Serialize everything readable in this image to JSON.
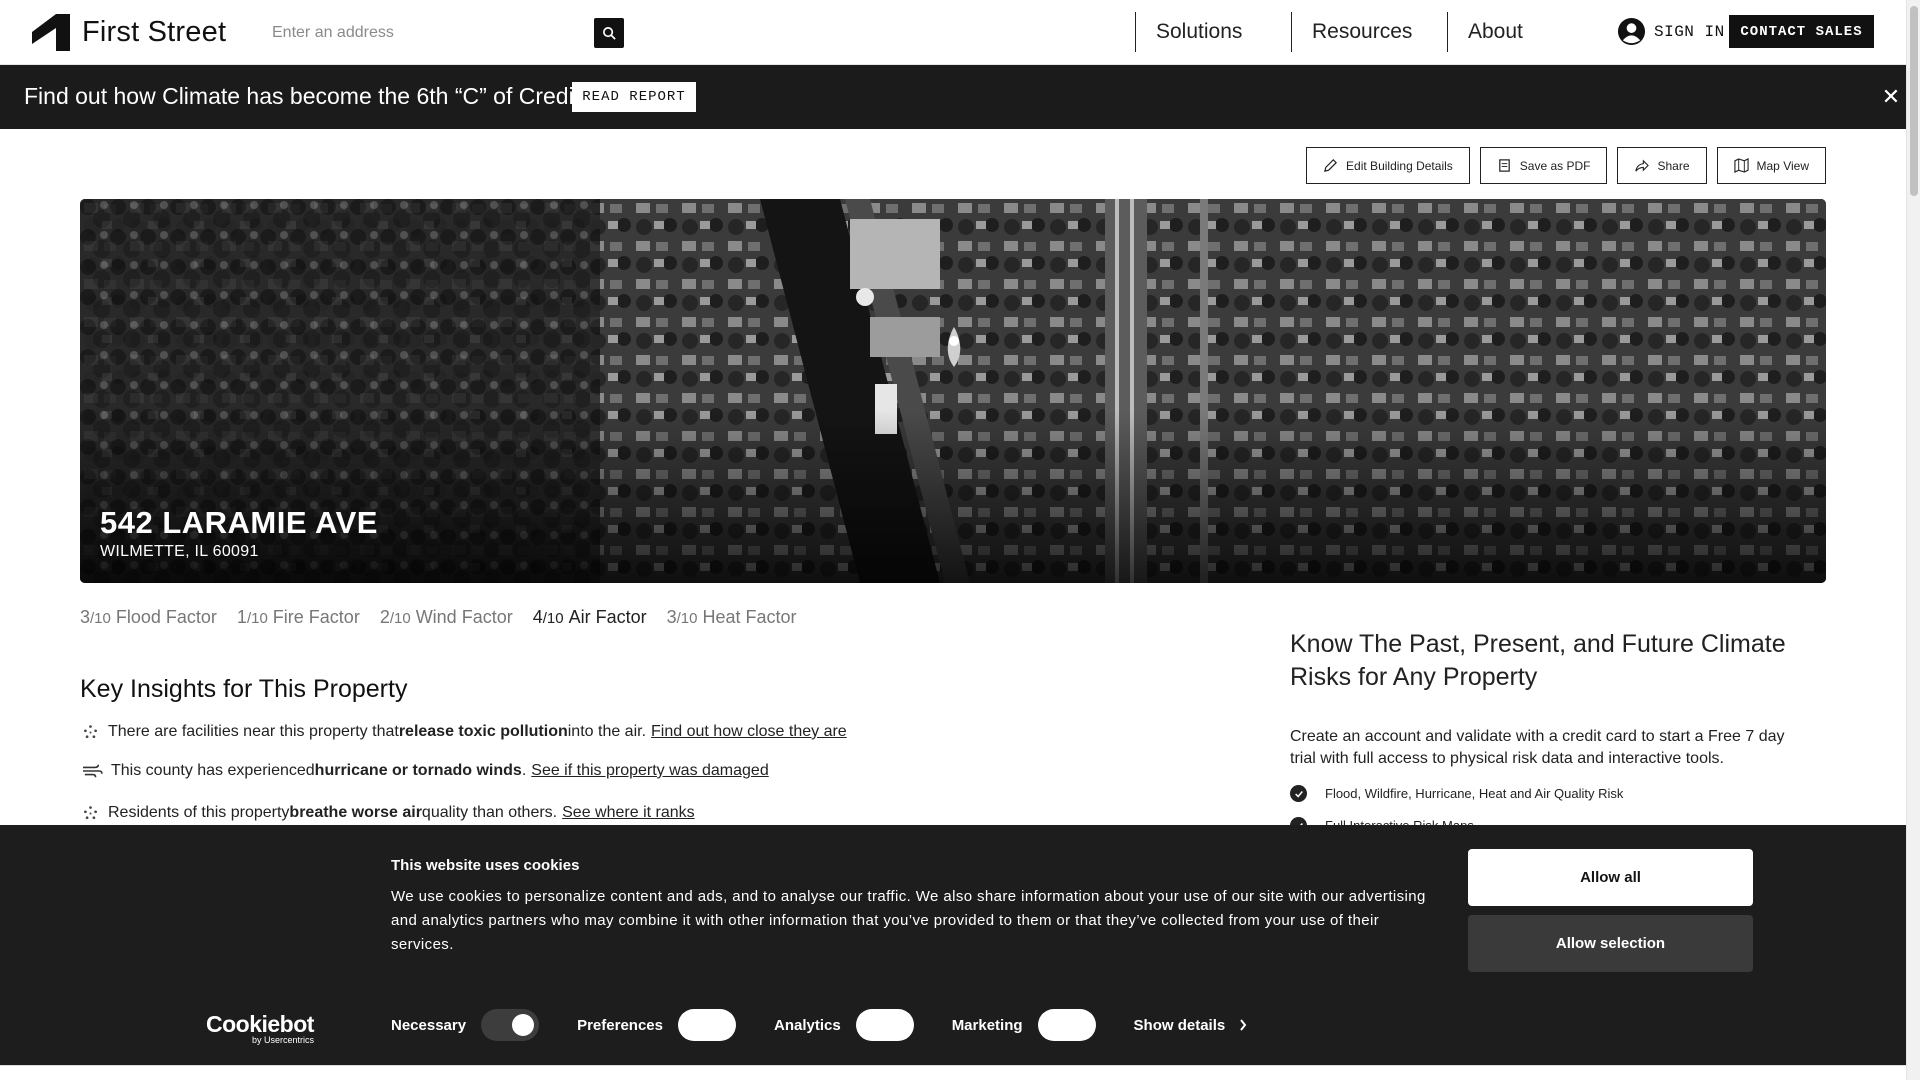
{
  "header": {
    "logo_text": "First Street",
    "search_placeholder": "Enter an address",
    "nav": [
      "Solutions",
      "Resources",
      "About"
    ],
    "sign_in": "SIGN IN",
    "contact": "CONTACT SALES"
  },
  "banner": {
    "text": "Find out how Climate has become the 6th “C” of Credit",
    "button": "READ REPORT",
    "close": "✕"
  },
  "actions": {
    "edit": "Edit Building Details",
    "pdf": "Save as PDF",
    "share": "Share",
    "map": "Map View"
  },
  "property": {
    "address": "542 LARAMIE AVE",
    "city": "WILMETTE, IL 60091"
  },
  "factors": [
    {
      "score": "3",
      "max": "/10",
      "label": "Flood Factor"
    },
    {
      "score": "1",
      "max": "/10",
      "label": "Fire Factor"
    },
    {
      "score": "2",
      "max": "/10",
      "label": "Wind Factor"
    },
    {
      "score": "4",
      "max": "/10",
      "label": "Air Factor"
    },
    {
      "score": "3",
      "max": "/10",
      "label": "Heat Factor"
    }
  ],
  "insights": {
    "title": "Key Insights for This Property",
    "items": [
      {
        "pre": "There are facilities near this property that ",
        "bold": "release toxic pollution",
        "post": " into the air.",
        "link": "Find out how close they are"
      },
      {
        "pre": "This county has experienced ",
        "bold": "hurricane or tornado winds",
        "post": ".",
        "link": "See if this property was damaged"
      },
      {
        "pre": "Residents of this property ",
        "bold": "breathe worse air",
        "post": " quality than others.",
        "link": "See where it ranks"
      }
    ]
  },
  "panel": {
    "title": "Know The Past, Present, and Future Climate Risks for Any Property",
    "desc": "Create an account and validate with a credit card to start a Free 7 day trial with full access to physical risk data and interactive tools.",
    "features": [
      "Flood, Wildfire, Hurricane, Heat and Air Quality Risk",
      "Full Interactive Risk Maps"
    ]
  },
  "cookie": {
    "title": "This website uses cookies",
    "text": "We use cookies to personalize content and ads, and to analyse our traffic. We also share information about your use of our site with our advertising and analytics partners who may combine it with other information that you’ve provided to them or that they’ve collected from your use of their services.",
    "allow_all": "Allow all",
    "allow_selection": "Allow selection",
    "brand": "Cookiebot",
    "brand_sub": "by Usercentrics",
    "toggles": [
      {
        "label": "Necessary",
        "on": true
      },
      {
        "label": "Preferences",
        "on": false
      },
      {
        "label": "Analytics",
        "on": false
      },
      {
        "label": "Marketing",
        "on": false
      }
    ],
    "show_details": "Show details"
  }
}
